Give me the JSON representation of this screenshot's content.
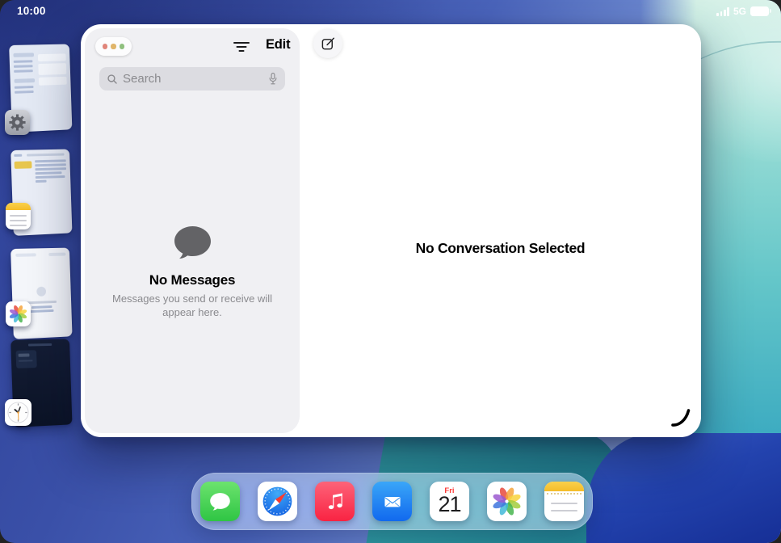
{
  "status_bar": {
    "time": "10:00",
    "network": "5G",
    "signal_icon": "cellular-signal-bars",
    "battery_icon": "battery-full"
  },
  "stage_manager": {
    "apps": [
      {
        "name": "Settings",
        "icon": "settings-gear-icon"
      },
      {
        "name": "Notes",
        "icon": "notes-icon"
      },
      {
        "name": "Photos",
        "icon": "photos-flower-icon"
      },
      {
        "name": "Clock",
        "icon": "clock-icon"
      }
    ]
  },
  "window": {
    "app": "Messages",
    "sidebar": {
      "edit_label": "Edit",
      "search_placeholder": "Search",
      "empty_title": "No Messages",
      "empty_subtitle": "Messages you send or receive will appear here."
    },
    "main": {
      "empty_title": "No Conversation Selected"
    }
  },
  "dock": {
    "apps": [
      "Messages",
      "Safari",
      "Music",
      "Mail",
      "Calendar",
      "Photos",
      "Notes"
    ],
    "calendar": {
      "weekday": "Fri",
      "day": "21"
    }
  },
  "colors": {
    "wallpaper_blue": "#3a50a8",
    "wallpaper_teal": "#35a6bf",
    "messages_green": "#2fc544",
    "music_red": "#f92342",
    "mail_blue": "#1169ee",
    "calendar_red": "#fc3d39",
    "notes_yellow": "#f5bd29"
  }
}
